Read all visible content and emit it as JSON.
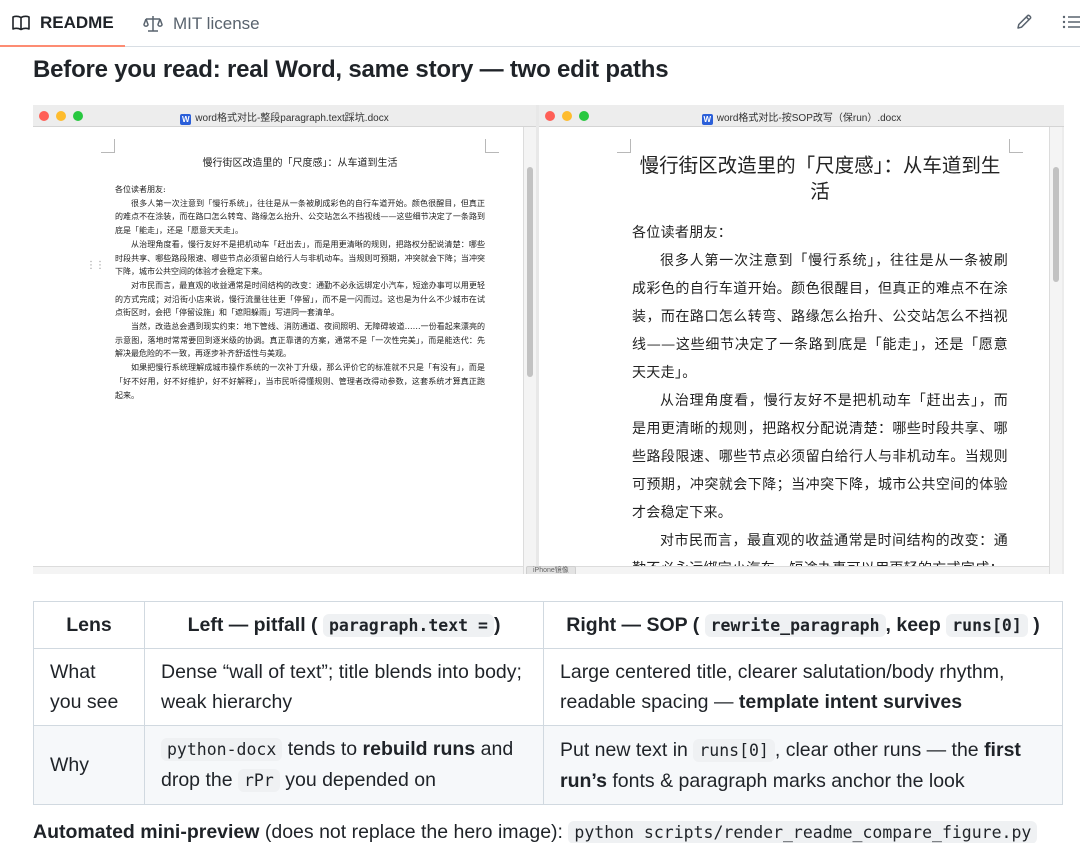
{
  "tabs": [
    {
      "label": "README",
      "icon": "book-icon",
      "active": true
    },
    {
      "label": "MIT license",
      "icon": "scale-icon",
      "active": false
    }
  ],
  "toolbar": {
    "edit_icon": "pencil-icon",
    "outline_icon": "list-icon"
  },
  "page_title": "Before you read: real Word, same story — two edit paths",
  "hero": {
    "left_window": {
      "title": "word格式对比-整段paragraph.text踩坑.docx",
      "doc_title": "慢行街区改造里的「尺度感」：从车道到生活",
      "salutation": "各位读者朋友:",
      "paragraphs": [
        "很多人第一次注意到「慢行系统」，往往是从一条被刷成彩色的自行车道开始。颜色很醒目，但真正的难点不在涂装，而在路口怎么转弯、路缘怎么抬升、公交站怎么不挡视线——这些细节决定了一条路到底是「能走」，还是「愿意天天走」。",
        "从治理角度看，慢行友好不是把机动车「赶出去」，而是用更清晰的规则，把路权分配说清楚：哪些时段共享、哪些路段限速、哪些节点必须留白给行人与非机动车。当规则可预期，冲突就会下降；当冲突下降，城市公共空间的体验才会稳定下来。",
        "对市民而言，最直观的收益通常是时间结构的改变：通勤不必永远绑定小汽车，短途办事可以用更轻的方式完成；对沿街小店来说，慢行流量往往更「停留」，而不是一闪而过。这也是为什么不少城市在试点街区时，会把「停留设施」和「遮阳躲雨」写进同一套清单。",
        "当然，改造总会遇到现实约束：地下管线、消防通道、夜间照明、无障碍坡道……一份看起来漂亮的示意图，落地时常常要回到逐米级的协调。真正靠谱的方案，通常不是「一次性完美」，而是能迭代：先解决最危险的不一致，再逐步补齐舒适性与美观。",
        "如果把慢行系统理解成城市操作系统的一次补丁升级，那么评价它的标准就不只是「有没有」，而是「好不好用，好不好维护，好不好解释」，当市民听得懂规则、管理者改得动参数，这套系统才算真正跑起来。"
      ]
    },
    "right_window": {
      "title": "word格式对比-按SOP改写（保run）.docx",
      "doc_title": "慢行街区改造里的「尺度感」：从车道到生活",
      "salutation": "各位读者朋友：",
      "paragraphs": [
        "很多人第一次注意到「慢行系统」，往往是从一条被刷成彩色的自行车道开始。颜色很醒目，但真正的难点不在涂装，而在路口怎么转弯、路缘怎么抬升、公交站怎么不挡视线——这些细节决定了一条路到底是「能走」，还是「愿意天天走」。",
        "从治理角度看，慢行友好不是把机动车「赶出去」，而是用更清晰的规则，把路权分配说清楚：哪些时段共享、哪些路段限速、哪些节点必须留白给行人与非机动车。当规则可预期，冲突就会下降；当冲突下降，城市公共空间的体验才会稳定下来。",
        "对市民而言，最直观的收益通常是时间结构的改变：通勤不必永远绑定小汽车，短途办事可以用更轻的方式完成；"
      ]
    },
    "status_tag": "iPhone镜像"
  },
  "table": {
    "headers": {
      "lens": "Lens",
      "left_prefix": "Left — pitfall (",
      "left_code": "paragraph.text =",
      "left_suffix": ")",
      "right_prefix": "Right — SOP (",
      "right_code1": "rewrite_paragraph",
      "right_mid": ", keep",
      "right_code2": "runs[0]",
      "right_suffix": ")"
    },
    "rows": [
      {
        "lens": "What you see",
        "left": "Dense “wall of text”; title blends into body; weak hierarchy",
        "right_text": "Large centered title, clearer salutation/body rhythm, readable spacing —",
        "right_bold": "template intent survives"
      },
      {
        "lens": "Why",
        "left_code1": "python-docx",
        "left_t1": "tends to",
        "left_b1": "rebuild runs",
        "left_t2": "and drop the",
        "left_code2": "rPr",
        "left_t3": "you depended on",
        "right_t1": "Put new text in",
        "right_code": "runs[0]",
        "right_t2": ", clear other runs — the",
        "right_b1": "first run’s",
        "right_t3": "fonts & paragraph marks anchor the look"
      }
    ]
  },
  "footnote": {
    "bold": "Automated mini-preview",
    "text": "(does not replace the hero image):",
    "code": "python scripts/render_readme_compare_figure.py"
  }
}
